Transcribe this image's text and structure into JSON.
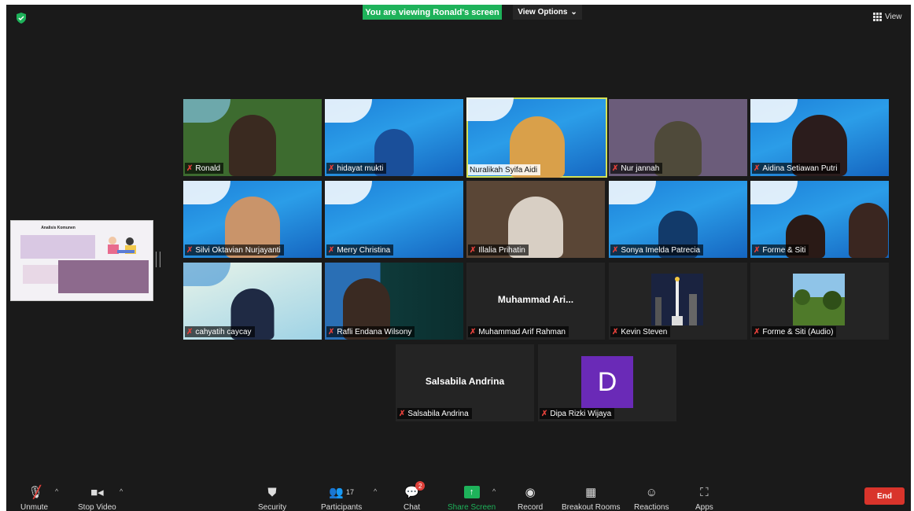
{
  "banner": {
    "text": "You are viewing Ronald's screen",
    "view_options": "View Options"
  },
  "view_button": "View",
  "shared_screen": {
    "title": "Analisis Komunen"
  },
  "participants": [
    {
      "name": "Ronald"
    },
    {
      "name": "hidayat mukti"
    },
    {
      "name": "Nuralikah Syifa Aidi"
    },
    {
      "name": "Nur jannah"
    },
    {
      "name": "Aidina Setiawan Putri"
    },
    {
      "name": "Silvi Oktavian Nurjayanti"
    },
    {
      "name": "Merry Christina"
    },
    {
      "name": "Illalia Prihatin"
    },
    {
      "name": "Sonya Imelda Patrecia"
    },
    {
      "name": "Forme & Siti"
    },
    {
      "name": "cahyatih caycay"
    },
    {
      "name": "Rafli Endana Wilsony"
    },
    {
      "name": "Muhammad Arif Rahman",
      "display": "Muhammad Ari..."
    },
    {
      "name": "Kevin Steven"
    },
    {
      "name": "Forme & Siti (Audio)"
    },
    {
      "name": "Salsabila Andrina",
      "display": "Salsabila Andrina"
    },
    {
      "name": "Dipa Rizki Wijaya",
      "initial": "D"
    }
  ],
  "toolbar": {
    "unmute": "Unmute",
    "stop_video": "Stop Video",
    "security": "Security",
    "participants": "Participants",
    "participants_count": "17",
    "chat": "Chat",
    "chat_badge": "2",
    "share_screen": "Share Screen",
    "record": "Record",
    "breakout_rooms": "Breakout Rooms",
    "reactions": "Reactions",
    "apps": "Apps",
    "end": "End"
  },
  "colors": {
    "banner": "#1eb25a",
    "end": "#d9342b",
    "share": "#1eb25a",
    "active_speaker": "#d4e157",
    "avatar": "#6a2ab7"
  }
}
